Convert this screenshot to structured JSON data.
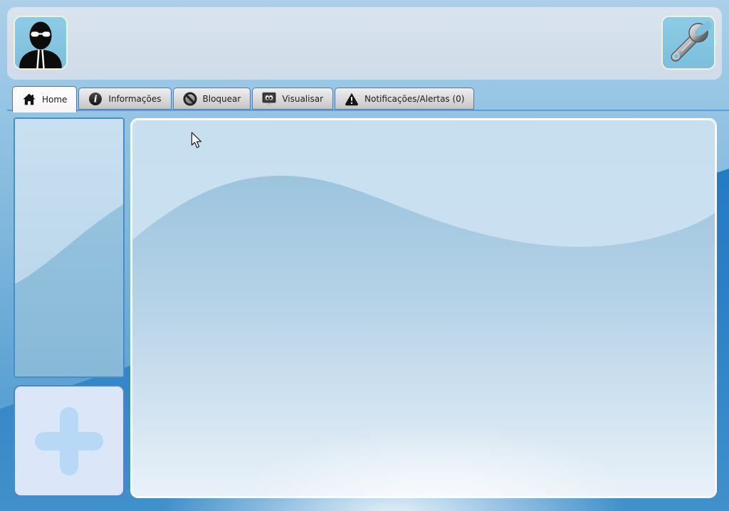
{
  "header": {
    "avatar_icon": "spy-person-icon",
    "tools_icon": "wrench-icon"
  },
  "tabs": {
    "items": [
      {
        "label": "Home",
        "icon": "home-icon",
        "active": true
      },
      {
        "label": "Informações",
        "icon": "info-icon",
        "active": false
      },
      {
        "label": "Bloquear",
        "icon": "block-icon",
        "active": false
      },
      {
        "label": "Visualisar",
        "icon": "monitor-eyes-icon",
        "active": false
      },
      {
        "label": "Notificações/Alertas (0)",
        "icon": "warning-icon",
        "active": false
      }
    ]
  },
  "sidebar": {
    "profile_panel_content": "",
    "add_button_symbol": "+"
  },
  "main": {
    "content": ""
  },
  "colors": {
    "accent_blue": "#2e81c6",
    "background_dark_band": "#1b76c1",
    "tab_border": "#3d80c6",
    "tab_underline": "#5a9ae0",
    "header_bg": "#d3dfeb",
    "icon_button_bg": "#85c5e1",
    "icon_button_border": "#f1f2da",
    "panel_border": "#4a8cca",
    "add_button_bg": "#dce6f9",
    "plus_sign": "#b7d9f5",
    "main_panel_border": "#fafdfe",
    "wave_blue": "#9cc4de"
  }
}
